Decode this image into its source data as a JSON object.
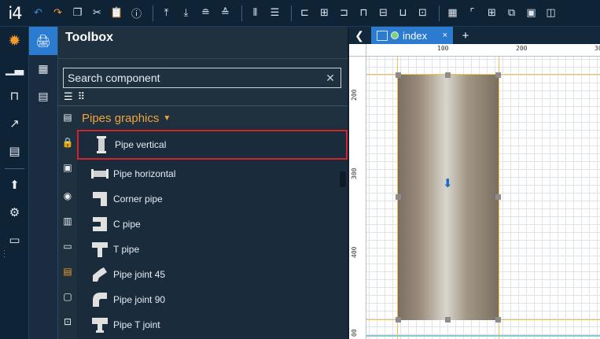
{
  "app": {
    "logo": "i4"
  },
  "toolbar": {
    "buttons": [
      "undo-icon",
      "redo-icon",
      "copy-icon",
      "cut-icon",
      "paste-icon",
      "info-icon",
      "align-top-icon",
      "align-bottom-icon",
      "align-top-line-icon",
      "align-bottom-line-icon",
      "distribute-horizontal-icon",
      "distribute-vertical-icon",
      "align-left-icon",
      "align-center-horizontal-icon",
      "align-right-icon",
      "align-top-edge-icon",
      "align-center-vertical-icon",
      "align-bottom-edge-icon",
      "center-icon",
      "grid-icon",
      "corner-icon",
      "snap-grid-icon",
      "snap-objects-icon",
      "fit-icon",
      "zoom-icon"
    ]
  },
  "toolbox": {
    "title": "Toolbox",
    "search": {
      "placeholder": "Search component",
      "value": ""
    },
    "category": "Pipes graphics",
    "items": [
      {
        "label": "Pipe vertical",
        "icon": "pipe-vertical-icon",
        "selected": true
      },
      {
        "label": "Pipe horizontal",
        "icon": "pipe-horizontal-icon"
      },
      {
        "label": "Corner pipe",
        "icon": "corner-pipe-icon"
      },
      {
        "label": "C pipe",
        "icon": "c-pipe-icon"
      },
      {
        "label": "T pipe",
        "icon": "t-pipe-icon"
      },
      {
        "label": "Pipe joint 45",
        "icon": "pipe-joint-45-icon"
      },
      {
        "label": "Pipe joint 90",
        "icon": "pipe-joint-90-icon"
      },
      {
        "label": "Pipe T joint",
        "icon": "pipe-t-joint-icon"
      }
    ]
  },
  "editor": {
    "tab": {
      "label": "index",
      "close": "×"
    },
    "add_tab": "+",
    "ruler_top": [
      "100",
      "200",
      "30"
    ],
    "ruler_left": [
      "200",
      "300",
      "400",
      "00"
    ]
  },
  "colors": {
    "accent": "#2b7bd1",
    "category": "#f3a33a",
    "selection": "#d2232a",
    "pipe": "#9a8d7c"
  }
}
